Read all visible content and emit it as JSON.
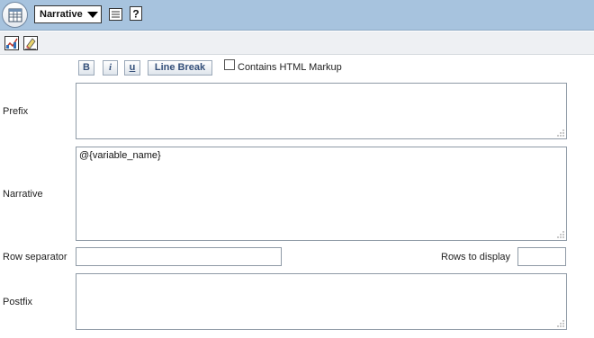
{
  "header": {
    "view_select": {
      "value": "Narrative"
    },
    "help_glyph": "?"
  },
  "format": {
    "bold": "B",
    "italic": "i",
    "underline": "u",
    "line_break": "Line Break",
    "contains_html_label": "Contains HTML Markup",
    "contains_html_checked": false
  },
  "fields": {
    "prefix": {
      "label": "Prefix",
      "value": ""
    },
    "narrative": {
      "label": "Narrative",
      "value": "@{variable_name}"
    },
    "row_separator": {
      "label": "Row separator",
      "value": ""
    },
    "rows_to_display": {
      "label": "Rows to display",
      "value": ""
    },
    "postfix": {
      "label": "Postfix",
      "value": ""
    }
  },
  "colors": {
    "header_bg": "#a7c3de",
    "toolbar_bg": "#eef0f3",
    "button_text": "#35507a"
  },
  "icons": {
    "view": "table-view-icon",
    "properties": "properties-icon",
    "help": "help-icon",
    "chart_tool": "chart-icon",
    "clear_tool": "eraser-icon"
  }
}
